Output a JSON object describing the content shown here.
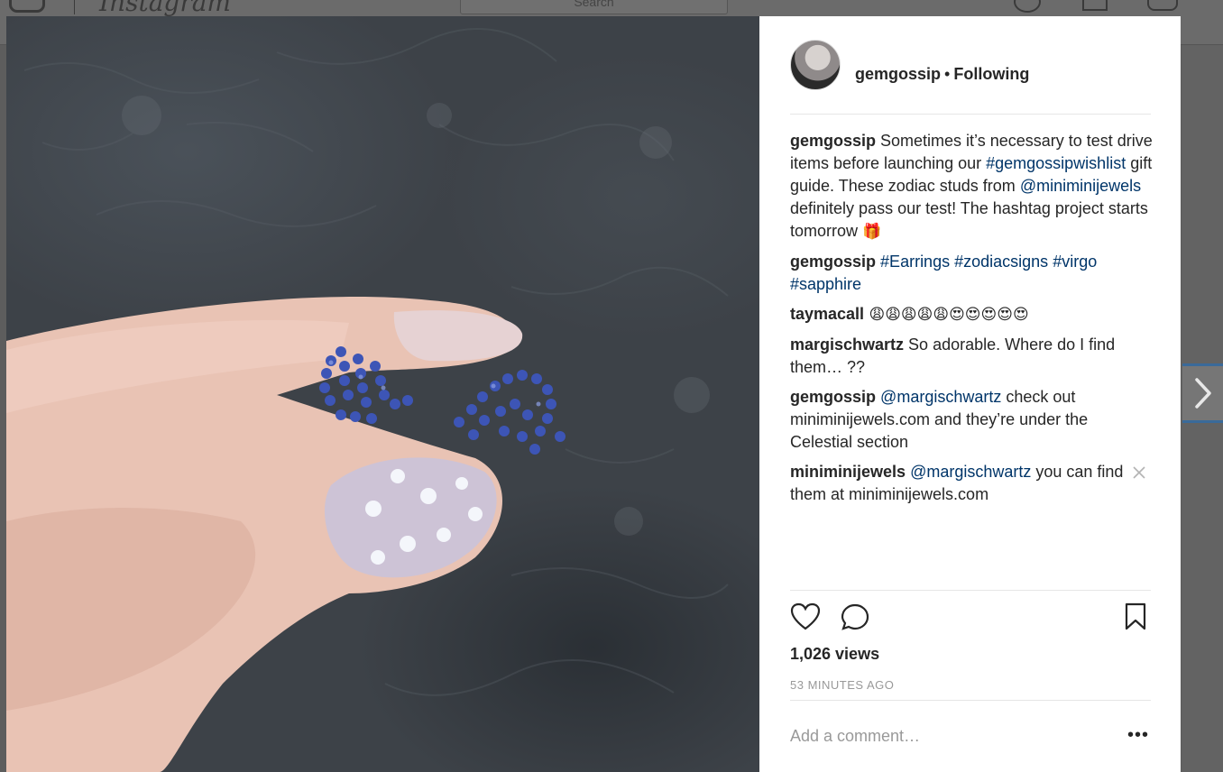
{
  "background_header": {
    "wordmark": "Instagram",
    "search_placeholder": "Search"
  },
  "post": {
    "username": "gemgossip",
    "separator": "•",
    "follow_status": "Following",
    "comments": [
      {
        "user": "gemgossip",
        "segments": [
          {
            "text": " Sometimes it’s necessary to test drive items before launching our "
          },
          {
            "text": "#gemgossipwishlist",
            "link": true
          },
          {
            "text": " gift guide. These zodiac studs from "
          },
          {
            "text": "@miniminijewels",
            "link": true
          },
          {
            "text": " definitely pass our test! The hashtag project starts tomorrow "
          },
          {
            "text": "🎁",
            "emoji": true
          }
        ]
      },
      {
        "user": "gemgossip",
        "segments": [
          {
            "text": " "
          },
          {
            "text": "#Earrings",
            "link": true
          },
          {
            "text": " "
          },
          {
            "text": "#zodiacsigns",
            "link": true
          },
          {
            "text": " "
          },
          {
            "text": "#virgo",
            "link": true
          },
          {
            "text": " "
          },
          {
            "text": "#sapphire",
            "link": true
          }
        ]
      },
      {
        "user": "taymacall",
        "segments": [
          {
            "text": " 😩😩😩😩😩😍😍😍😍😍",
            "emoji": true
          }
        ]
      },
      {
        "user": "margischwartz",
        "segments": [
          {
            "text": " So adorable. Where do I find them… ??"
          }
        ]
      },
      {
        "user": "gemgossip",
        "segments": [
          {
            "text": " "
          },
          {
            "text": "@margischwartz",
            "link": true
          },
          {
            "text": " check out miniminijewels.com and they’re under the Celestial section"
          }
        ]
      },
      {
        "user": "miniminijewels",
        "deletable": true,
        "segments": [
          {
            "text": " "
          },
          {
            "text": "@margischwartz",
            "link": true
          },
          {
            "text": " you can find them at miniminijewels.com"
          }
        ]
      }
    ],
    "views": "1,026 views",
    "timestamp": "53 MINUTES AGO",
    "comment_placeholder": "Add a comment…",
    "more_label": "•••"
  },
  "icons": {
    "like": "heart-icon",
    "comment": "comment-bubble-icon",
    "save": "bookmark-icon",
    "next": "chevron-right-icon",
    "close": "close-icon"
  },
  "colors": {
    "link": "#003569",
    "text": "#262626",
    "muted": "#999999"
  }
}
